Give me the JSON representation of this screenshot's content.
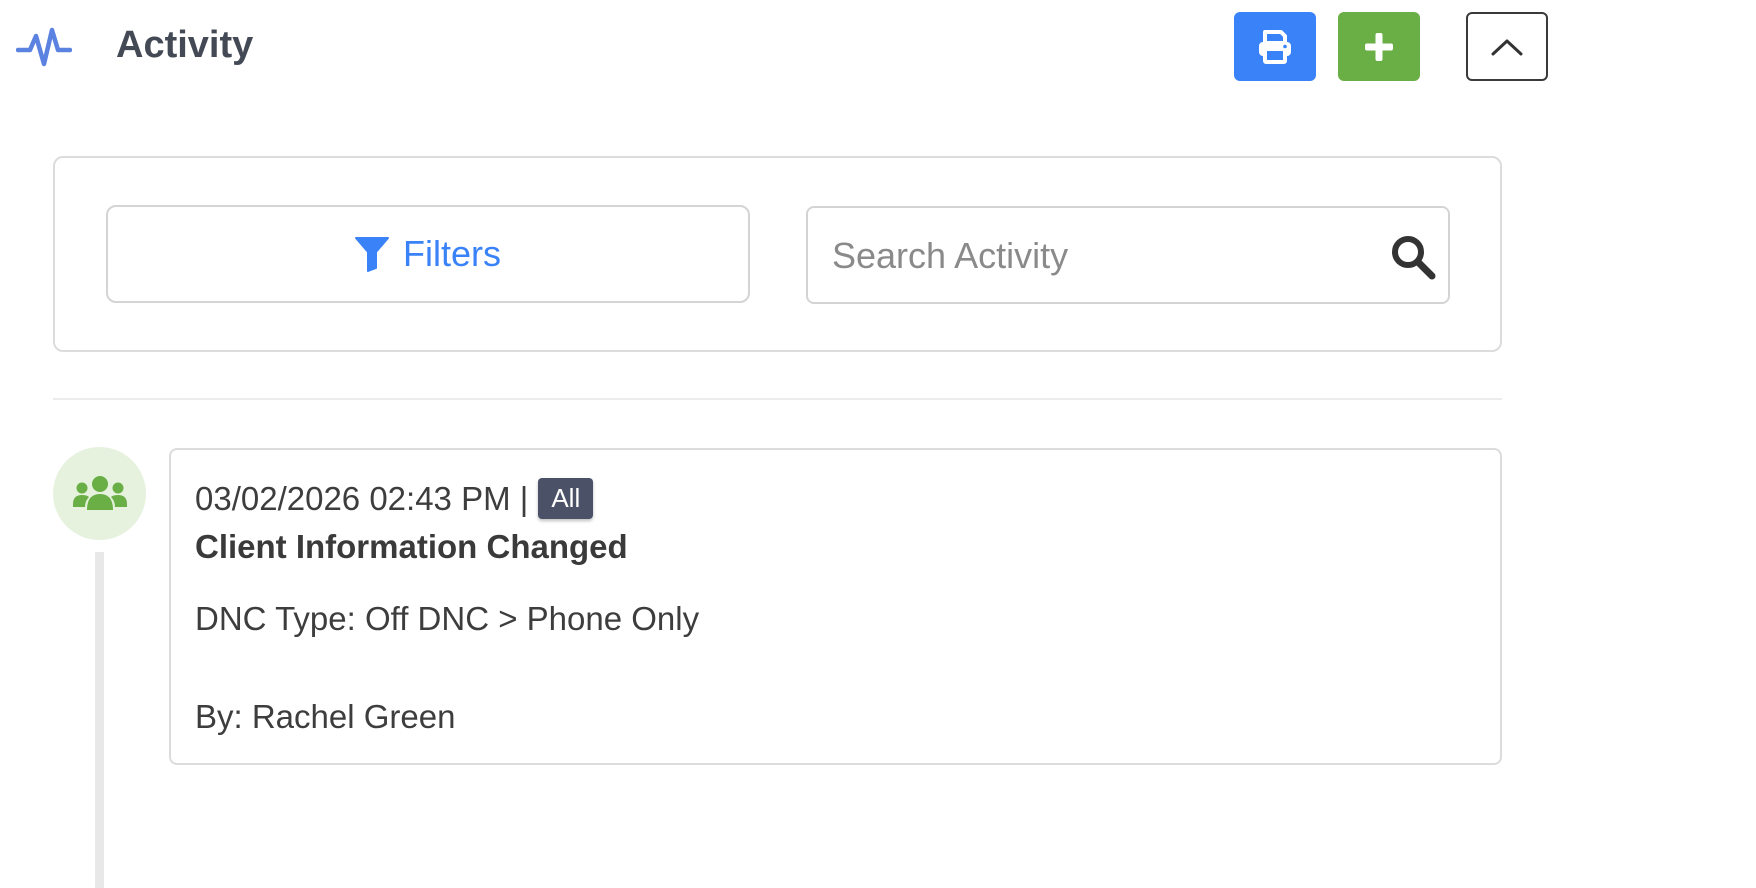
{
  "header": {
    "icon": "activity-pulse-icon",
    "title": "Activity",
    "accent_color": "#3a82f7",
    "buttons": {
      "print": {
        "icon": "printer-icon",
        "color": "#3a82f7"
      },
      "add": {
        "icon": "plus-icon",
        "color": "#6aae46"
      },
      "collapse": {
        "icon": "chevron-up-icon"
      }
    }
  },
  "filter_panel": {
    "filters_label": "Filters",
    "filters_icon": "filter-funnel-icon",
    "search_placeholder": "Search Activity",
    "search_value": "",
    "search_icon": "magnifier-icon"
  },
  "activities": [
    {
      "icon": "users-group-icon",
      "icon_color": "#6aae46",
      "timestamp": "03/02/2026 02:43 PM |",
      "badge": "All",
      "title": "Client Information Changed",
      "detail": "DNC Type: Off DNC > Phone Only",
      "author": "By: Rachel Green"
    }
  ]
}
